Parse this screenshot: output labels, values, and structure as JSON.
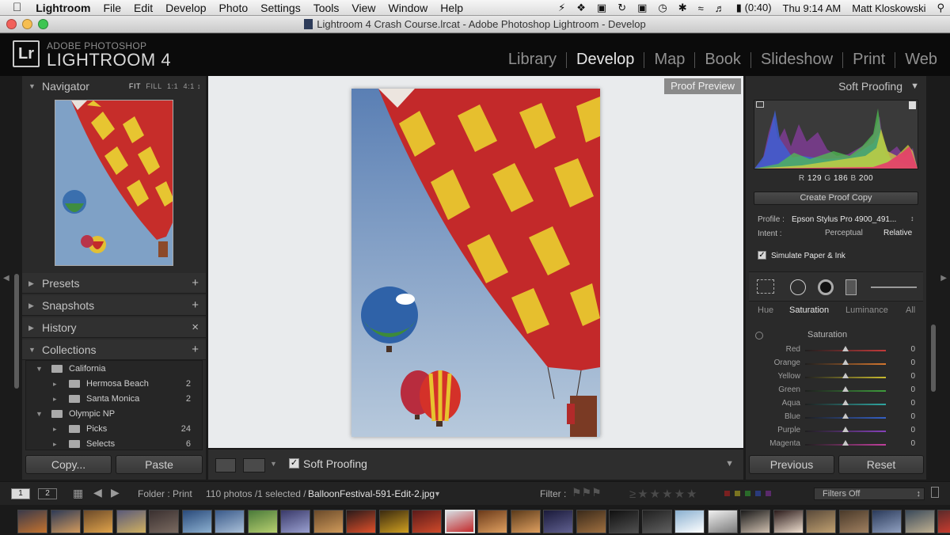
{
  "menubar": {
    "app": "Lightroom",
    "items": [
      "File",
      "Edit",
      "Develop",
      "Photo",
      "Settings",
      "Tools",
      "View",
      "Window",
      "Help"
    ],
    "battery": "(0:40)",
    "clock": "Thu 9:14 AM",
    "user": "Matt Kloskowski"
  },
  "window": {
    "title": "Lightroom 4 Crash Course.lrcat - Adobe Photoshop Lightroom - Develop"
  },
  "brand": {
    "badge": "Lr",
    "line1": "ADOBE PHOTOSHOP",
    "line2": "LIGHTROOM 4"
  },
  "modules": [
    {
      "label": "Library",
      "active": false
    },
    {
      "label": "Develop",
      "active": true
    },
    {
      "label": "Map",
      "active": false
    },
    {
      "label": "Book",
      "active": false
    },
    {
      "label": "Slideshow",
      "active": false
    },
    {
      "label": "Print",
      "active": false
    },
    {
      "label": "Web",
      "active": false
    }
  ],
  "left": {
    "navigator": {
      "title": "Navigator",
      "fit": "FIT",
      "fill": "FILL",
      "one": "1:1",
      "four": "4:1"
    },
    "presets": "Presets",
    "snapshots": "Snapshots",
    "history": "History",
    "collections": "Collections",
    "tree": [
      {
        "name": "California",
        "count": "",
        "level": 0
      },
      {
        "name": "Hermosa Beach",
        "count": "2",
        "level": 1
      },
      {
        "name": "Santa Monica",
        "count": "2",
        "level": 1
      },
      {
        "name": "Olympic NP",
        "count": "",
        "level": 0
      },
      {
        "name": "Picks",
        "count": "24",
        "level": 1
      },
      {
        "name": "Selects",
        "count": "6",
        "level": 1
      }
    ],
    "copy": "Copy...",
    "paste": "Paste"
  },
  "center": {
    "proof_label": "Proof Preview",
    "soft_proofing": "Soft Proofing"
  },
  "right": {
    "title": "Soft Proofing",
    "rgb": {
      "r_label": "R",
      "r": "129",
      "g_label": "G",
      "g": "186",
      "b_label": "B",
      "b": "200"
    },
    "create_copy": "Create Proof Copy",
    "profile_label": "Profile :",
    "profile_value": "Epson Stylus Pro 4900_491...",
    "intent_label": "Intent :",
    "perceptual": "Perceptual",
    "relative": "Relative",
    "simulate": "Simulate Paper & Ink",
    "tabs": [
      "Hue",
      "Saturation",
      "Luminance",
      "All"
    ],
    "section": "Saturation",
    "sliders": [
      {
        "label": "Red",
        "value": "0",
        "color": "#c33a3a"
      },
      {
        "label": "Orange",
        "value": "0",
        "color": "#d4762e"
      },
      {
        "label": "Yellow",
        "value": "0",
        "color": "#c9bb2f"
      },
      {
        "label": "Green",
        "value": "0",
        "color": "#3e9d3c"
      },
      {
        "label": "Aqua",
        "value": "0",
        "color": "#2fa6a1"
      },
      {
        "label": "Blue",
        "value": "0",
        "color": "#3460c6"
      },
      {
        "label": "Purple",
        "value": "0",
        "color": "#8641bb"
      },
      {
        "label": "Magenta",
        "value": "0",
        "color": "#c13f9d"
      }
    ],
    "previous": "Previous",
    "reset": "Reset"
  },
  "filmstrip": {
    "screen1": "1",
    "screen2": "2",
    "folder": "Folder : Print",
    "count": "110 photos /1 selected /",
    "filename": "BalloonFestival-591-Edit-2.jpg",
    "filter": "Filter :",
    "filters_off": "Filters Off"
  }
}
